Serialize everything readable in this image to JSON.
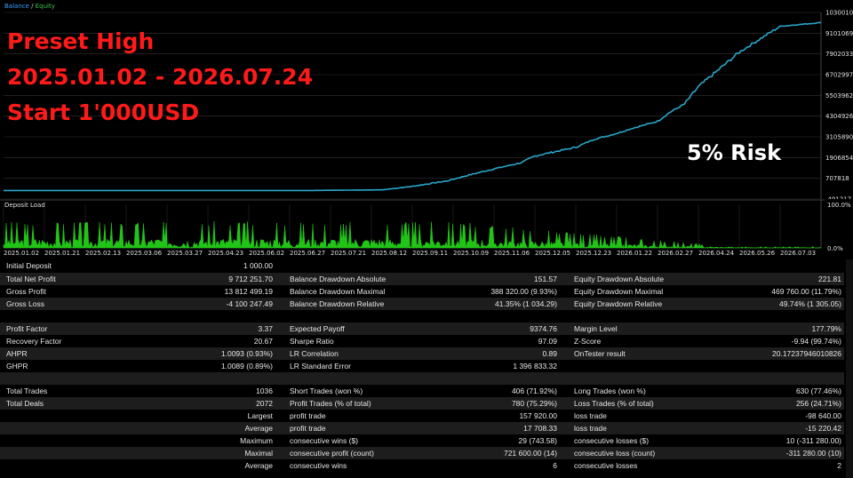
{
  "main_chart": {
    "legend": {
      "balance": "Balance",
      "sep": " / ",
      "equity": "Equity"
    },
    "y_ticks": [
      "10300105",
      "9101069",
      "7902033",
      "6702997",
      "5503962",
      "4304926",
      "3105890",
      "1906854",
      "707818",
      "-491217"
    ],
    "colors": {
      "line": "#2aa6c9",
      "grid": "#333333",
      "legend_balance": "#3aa0ff",
      "legend_equity": "#3cc24a"
    }
  },
  "chart_data": {
    "type": "line",
    "series": [
      {
        "name": "Balance",
        "x": [
          "2025.01.02",
          "2025.03.06",
          "2025.05.06",
          "2025.07.07",
          "2025.08.20",
          "2025.09.11",
          "2025.10.05",
          "2025.10.20",
          "2025.11.06",
          "2025.11.25",
          "2025.12.05",
          "2025.12.23",
          "2026.01.05",
          "2026.01.22",
          "2026.02.05",
          "2026.02.27",
          "2026.03.15",
          "2026.04.05",
          "2026.04.24",
          "2026.05.10",
          "2026.05.26",
          "2026.06.15",
          "2026.07.03",
          "2026.07.24"
        ],
        "values": [
          1000,
          1000,
          1000,
          1000,
          40000,
          240000,
          560000,
          900000,
          1250000,
          1600000,
          2000000,
          2500000,
          2950000,
          3300000,
          3600000,
          4000000,
          4500000,
          5000000,
          6000000,
          7000000,
          8000000,
          8800000,
          9500000,
          9713252
        ]
      }
    ],
    "xlabel": "",
    "ylabel": "",
    "ylim": [
      -491217,
      10300105
    ],
    "x_tick_labels": [
      "2025.01.02",
      "2025.01.21",
      "2025.02.13",
      "2025.03.06",
      "2025.03.27",
      "2025.04.23",
      "2025.06.02",
      "2025.06.27",
      "2025.07.21",
      "2025.08.12",
      "2025.09.11",
      "2025.10.09",
      "2025.11.06",
      "2025.12.05",
      "2025.12.23",
      "2026.01.22",
      "2026.02.27",
      "2026.04.24",
      "2026.05.26",
      "2026.07.03"
    ],
    "grid": true,
    "legend": "top-left"
  },
  "annotation": {
    "line1": "Preset High",
    "line2": "2025.01.02 - 2026.07.24",
    "line3": "Start 1'000USD",
    "risk": "5% Risk",
    "color": "#ff1a1a"
  },
  "deposit_load": {
    "title": "Deposit Load",
    "y_top": "100.0%",
    "y_bottom": "0.0%",
    "color": "#22c417",
    "x_ticks": [
      "2025.01.02",
      "2025.01.21",
      "2025.02.13",
      "2025.03.06",
      "2025.03.27",
      "2025.04.23",
      "2025.06.02",
      "2025.06.27",
      "2025.07.21",
      "2025.08.12",
      "2025.09.11",
      "2025.10.09",
      "2025.11.06",
      "2025.12.05",
      "2025.12.23",
      "2026.01.22",
      "2026.02.27",
      "2026.04.24",
      "2026.05.26",
      "2026.07.03"
    ]
  },
  "report": {
    "initial_deposit": {
      "label": "Initial Deposit",
      "value": "1 000.00"
    },
    "total_net_profit": {
      "label": "Total Net Profit",
      "value": "9 712 251.70"
    },
    "gross_profit": {
      "label": "Gross Profit",
      "value": "13 812 499.19"
    },
    "gross_loss": {
      "label": "Gross Loss",
      "value": "-4 100 247.49"
    },
    "bal_dd_abs": {
      "label": "Balance Drawdown Absolute",
      "value": "151.57"
    },
    "bal_dd_max": {
      "label": "Balance Drawdown Maximal",
      "value": "388 320.00 (9.93%)"
    },
    "bal_dd_rel": {
      "label": "Balance Drawdown Relative",
      "value": "41.35% (1 034.29)"
    },
    "eq_dd_abs": {
      "label": "Equity Drawdown Absolute",
      "value": "221.81"
    },
    "eq_dd_max": {
      "label": "Equity Drawdown Maximal",
      "value": "469 760.00 (11.79%)"
    },
    "eq_dd_rel": {
      "label": "Equity Drawdown Relative",
      "value": "49.74% (1 305.05)"
    },
    "profit_factor": {
      "label": "Profit Factor",
      "value": "3.37"
    },
    "recovery_factor": {
      "label": "Recovery Factor",
      "value": "20.67"
    },
    "ahpr": {
      "label": "AHPR",
      "value": "1.0093 (0.93%)"
    },
    "ghpr": {
      "label": "GHPR",
      "value": "1.0089 (0.89%)"
    },
    "expected_payoff": {
      "label": "Expected Payoff",
      "value": "9374.76"
    },
    "sharpe": {
      "label": "Sharpe Ratio",
      "value": "97.09"
    },
    "lr_corr": {
      "label": "LR Correlation",
      "value": "0.89"
    },
    "lr_se": {
      "label": "LR Standard Error",
      "value": "1 396 833.32"
    },
    "margin_level": {
      "label": "Margin Level",
      "value": "177.79%"
    },
    "z_score": {
      "label": "Z-Score",
      "value": "-9.94 (99.74%)"
    },
    "ontester": {
      "label": "OnTester result",
      "value": "20.17237946010826"
    },
    "total_trades": {
      "label": "Total Trades",
      "value": "1036"
    },
    "total_deals": {
      "label": "Total Deals",
      "value": "2072"
    },
    "short_trades": {
      "label": "Short Trades (won %)",
      "value": "406 (71.92%)"
    },
    "profit_trades": {
      "label": "Profit Trades (% of total)",
      "value": "780 (75.29%)"
    },
    "long_trades": {
      "label": "Long Trades (won %)",
      "value": "630 (77.46%)"
    },
    "loss_trades": {
      "label": "Loss Trades (% of total)",
      "value": "256 (24.71%)"
    },
    "largest": {
      "label": "Largest",
      "l2": "profit trade",
      "v2": "157 920.00",
      "l3": "loss trade",
      "v3": "-98 640.00"
    },
    "average": {
      "label": "Average",
      "l2": "profit trade",
      "v2": "17 708.33",
      "l3": "loss trade",
      "v3": "-15 220.42"
    },
    "maximum": {
      "label": "Maximum",
      "l2": "consecutive wins ($)",
      "v2": "29 (743.58)",
      "l3": "consecutive losses ($)",
      "v3": "10 (-311 280.00)"
    },
    "maximal": {
      "label": "Maximal",
      "l2": "consecutive profit (count)",
      "v2": "721 600.00 (14)",
      "l3": "consecutive loss (count)",
      "v3": "-311 280.00 (10)"
    },
    "average2": {
      "label": "Average",
      "l2": "consecutive wins",
      "v2": "6",
      "l3": "consecutive losses",
      "v3": "2"
    }
  }
}
